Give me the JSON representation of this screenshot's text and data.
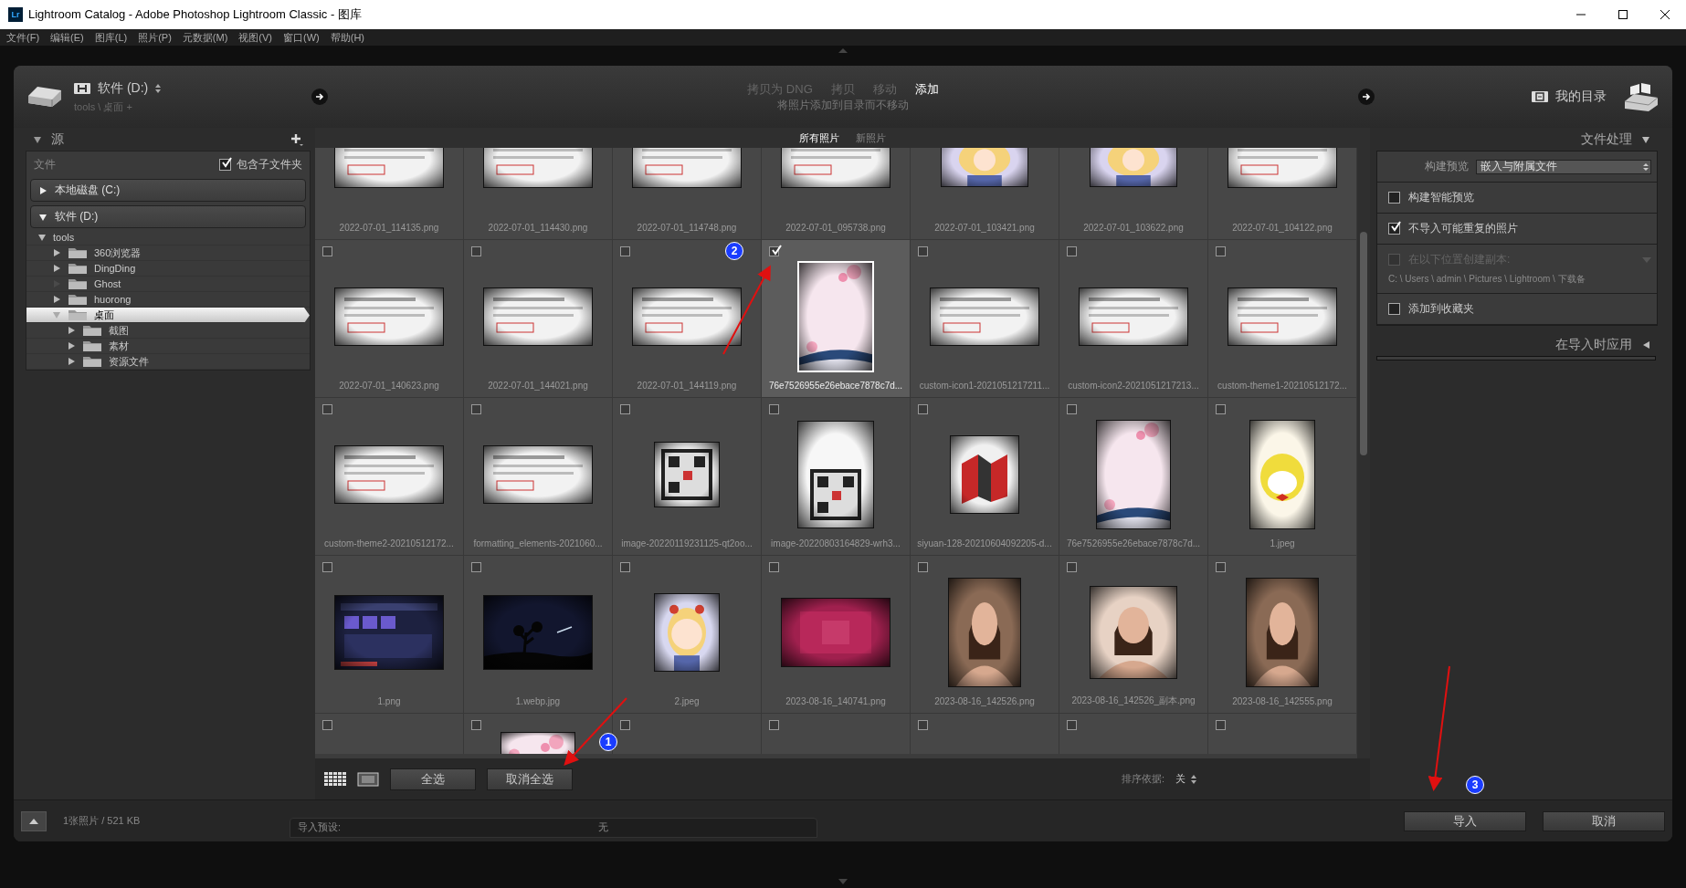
{
  "window": {
    "app_icon": "Lr",
    "title": "Lightroom Catalog - Adobe Photoshop Lightroom Classic - 图库"
  },
  "menu": [
    "文件(F)",
    "编辑(E)",
    "图库(L)",
    "照片(P)",
    "元数据(M)",
    "视图(V)",
    "窗口(W)",
    "帮助(H)"
  ],
  "source": {
    "volume": "软件 (D:)",
    "path": "tools \\ 桌面 +"
  },
  "modes": [
    {
      "label": "拷贝为 DNG",
      "selected": false
    },
    {
      "label": "拷贝",
      "selected": false
    },
    {
      "label": "移动",
      "selected": false
    },
    {
      "label": "添加",
      "selected": true
    }
  ],
  "mode_hint": "将照片添加到目录而不移动",
  "destination": {
    "label": "我的目录"
  },
  "left_panel": {
    "title": "源",
    "expanded": true,
    "files_label": "文件",
    "include_subfolders": {
      "label": "包含子文件夹",
      "checked": true
    },
    "volumes": [
      {
        "label": "本地磁盘 (C:)",
        "expanded": false
      },
      {
        "label": "软件 (D:)",
        "expanded": true,
        "children": [
          {
            "label": "tools",
            "expanded": true,
            "empty": false,
            "selected": false,
            "children": [
              {
                "label": "360浏览器",
                "expanded": false,
                "empty": false,
                "selected": false
              },
              {
                "label": "DingDing",
                "expanded": false,
                "empty": false,
                "selected": false
              },
              {
                "label": "Ghost",
                "expanded": false,
                "empty": true,
                "selected": false
              },
              {
                "label": "huorong",
                "expanded": false,
                "empty": false,
                "selected": false
              },
              {
                "label": "桌面",
                "expanded": true,
                "empty": false,
                "selected": true,
                "children": [
                  {
                    "label": "截图",
                    "expanded": false,
                    "empty": false,
                    "selected": false
                  },
                  {
                    "label": "素材",
                    "expanded": false,
                    "empty": false,
                    "selected": false
                  },
                  {
                    "label": "资源文件",
                    "expanded": false,
                    "empty": false,
                    "selected": false
                  }
                ]
              }
            ]
          }
        ]
      }
    ]
  },
  "grid": {
    "tabs": [
      {
        "label": "所有照片",
        "selected": true
      },
      {
        "label": "新照片",
        "selected": false
      }
    ],
    "rows": [
      [
        {
          "name": "2022-07-01_114135.png",
          "selected": false
        },
        {
          "name": "2022-07-01_114430.png",
          "selected": false
        },
        {
          "name": "2022-07-01_114748.png",
          "selected": false
        },
        {
          "name": "2022-07-01_095738.png",
          "selected": false
        },
        {
          "name": "2022-07-01_103421.png",
          "selected": false
        },
        {
          "name": "2022-07-01_103622.png",
          "selected": false
        },
        {
          "name": "2022-07-01_104122.png",
          "selected": false
        }
      ],
      [
        {
          "name": "2022-07-01_140623.png",
          "checked": false,
          "selected": false
        },
        {
          "name": "2022-07-01_144021.png",
          "checked": false,
          "selected": false
        },
        {
          "name": "2022-07-01_144119.png",
          "checked": false,
          "selected": false
        },
        {
          "name": "76e7526955e26ebace7878c7d...",
          "checked": true,
          "selected": true
        },
        {
          "name": "custom-icon1-2021051217211...",
          "checked": false,
          "selected": false
        },
        {
          "name": "custom-icon2-2021051217213...",
          "checked": false,
          "selected": false
        },
        {
          "name": "custom-theme1-20210512172...",
          "checked": false,
          "selected": false
        }
      ],
      [
        {
          "name": "custom-theme2-20210512172...",
          "checked": false,
          "selected": false
        },
        {
          "name": "formatting_elements-2021060...",
          "checked": false,
          "selected": false
        },
        {
          "name": "image-20220119231125-qt2oo...",
          "checked": false,
          "selected": false
        },
        {
          "name": "image-20220803164829-wrh3...",
          "checked": false,
          "selected": false
        },
        {
          "name": "siyuan-128-20210604092205-d...",
          "checked": false,
          "selected": false
        },
        {
          "name": "76e7526955e26ebace7878c7d...",
          "checked": false,
          "selected": false
        },
        {
          "name": "1.jpeg",
          "checked": false,
          "selected": false
        }
      ],
      [
        {
          "name": "1.png",
          "checked": false,
          "selected": false
        },
        {
          "name": "1.webp.jpg",
          "checked": false,
          "selected": false
        },
        {
          "name": "2.jpeg",
          "checked": false,
          "selected": false
        },
        {
          "name": "2023-08-16_140741.png",
          "checked": false,
          "selected": false
        },
        {
          "name": "2023-08-16_142526.png",
          "checked": false,
          "selected": false
        },
        {
          "name": "2023-08-16_142526_副本.png",
          "checked": false,
          "selected": false
        },
        {
          "name": "2023-08-16_142555.png",
          "checked": false,
          "selected": false
        }
      ],
      [
        {
          "checked": false,
          "selected": false
        },
        {
          "checked": false,
          "selected": false
        },
        {
          "checked": false,
          "selected": false
        },
        {
          "checked": false,
          "selected": false
        },
        {
          "checked": false,
          "selected": false
        },
        {
          "checked": false,
          "selected": false
        },
        {
          "checked": false,
          "selected": false
        }
      ]
    ]
  },
  "toolbar": {
    "select_all": "全选",
    "deselect_all": "取消全选",
    "sort_label": "排序依据:",
    "sort_value": "关"
  },
  "right_panel": {
    "title": "文件处理",
    "expanded": true,
    "build_preview_label": "构建预览",
    "build_preview_value": "嵌入与附属文件",
    "options": [
      {
        "label": "构建智能预览",
        "checked": false,
        "disabled": false
      },
      {
        "label": "不导入可能重复的照片",
        "checked": true,
        "disabled": false
      },
      {
        "label": "在以下位置创建副本:",
        "checked": false,
        "disabled": true,
        "path": "C: \\ Users \\ admin \\ Pictures \\ Lightroom \\ 下载备"
      },
      {
        "label": "添加到收藏夹",
        "checked": false,
        "disabled": false
      }
    ],
    "apply_section": {
      "title": "在导入时应用",
      "expanded": false
    }
  },
  "status": {
    "summary": "1张照片 / 521 KB",
    "preset_label": "导入预设:",
    "preset_value": "无",
    "import": "导入",
    "cancel": "取消"
  },
  "annotations": [
    {
      "label": "1"
    },
    {
      "label": "2"
    },
    {
      "label": "3"
    }
  ]
}
